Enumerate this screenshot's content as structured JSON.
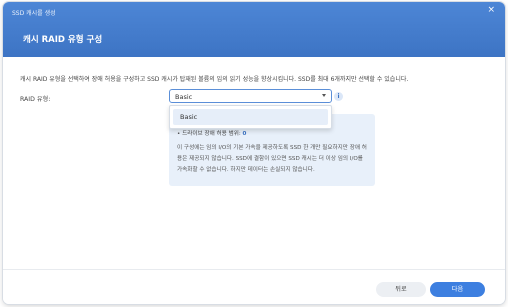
{
  "window": {
    "title": "SSD 캐시를 생성"
  },
  "header": {
    "step_title": "캐시 RAID 유형 구성"
  },
  "main": {
    "description": "캐시 RAID 유형을 선택하여 장애 허용을 구성하고 SSD 캐시가 탑재된 볼륨의 임의 읽기 성능을 향상시킵니다. SSD를 최대 6개까지만 선택할 수 있습니다.",
    "raid_label": "RAID 유형:",
    "raid_select": {
      "value": "Basic",
      "options": [
        "Basic"
      ]
    },
    "info_icon": "i",
    "info_panel": {
      "bullet_label": "• 드라이브 장애 허용 범위: ",
      "bullet_value": "0",
      "paragraph": "이 구성에는 임의 I/O의 기본 가속을 제공하도록 SSD 한 개만 필요하지만 장애 허용은 제공되지 않습니다. SSD에 결함이 있으면 SSD 캐시는 더 이상 임의 I/O를 가속화할 수 없습니다. 하지만 데이터는 손실되지 않습니다."
    }
  },
  "footer": {
    "back_label": "뒤로",
    "next_label": "다음"
  },
  "colors": {
    "header": "#3d74c4",
    "accent": "#3d7fe0",
    "panel": "#e8f0fa"
  }
}
